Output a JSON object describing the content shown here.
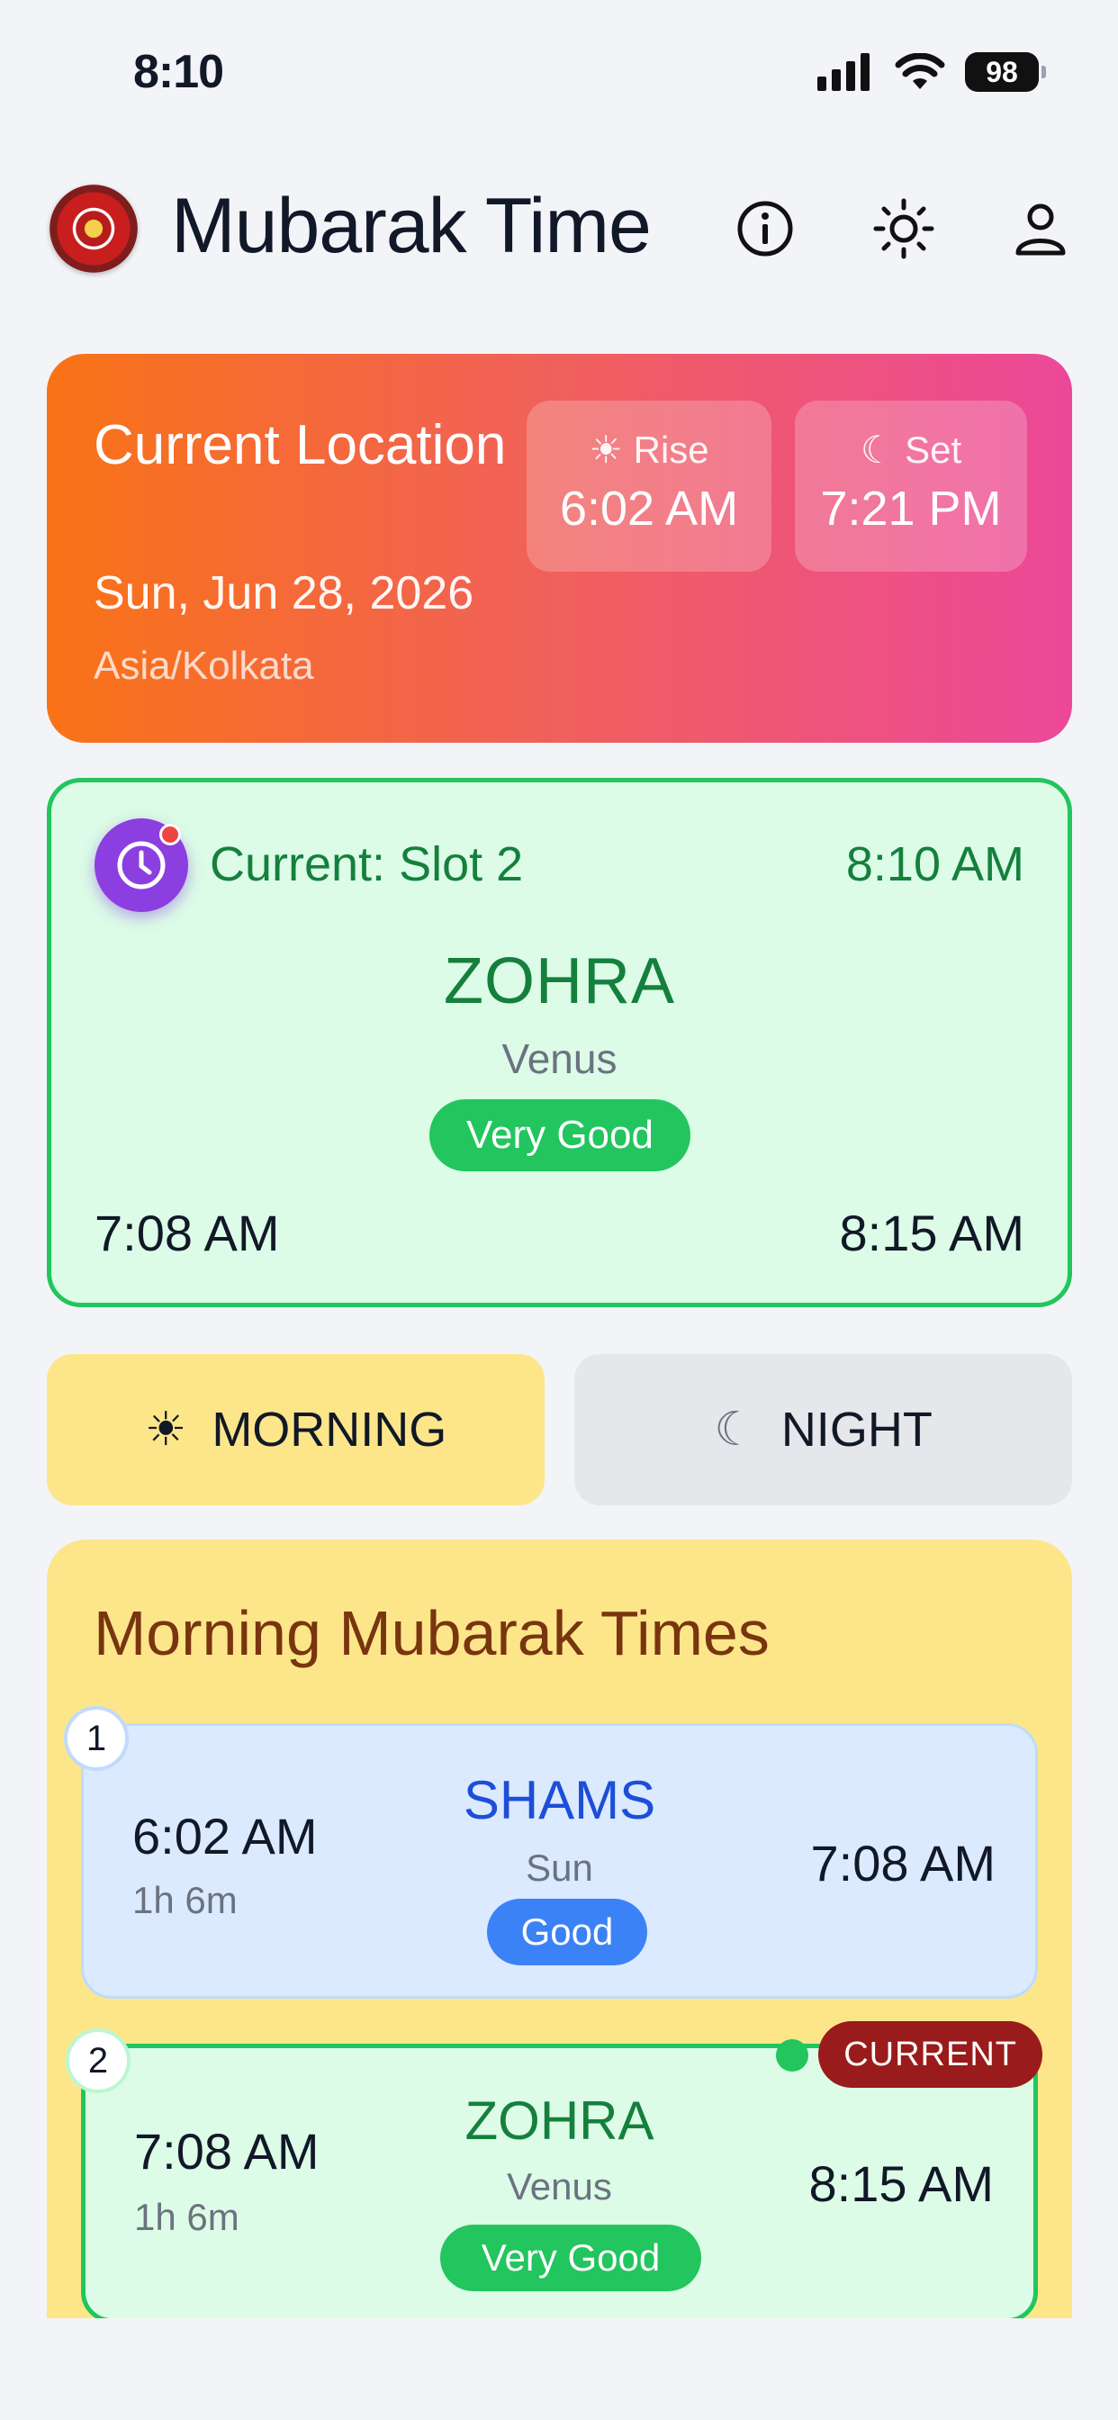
{
  "status_bar": {
    "time": "8:10",
    "battery": "98"
  },
  "header": {
    "title": "Mubarak Time"
  },
  "location": {
    "title": "Current Location",
    "date": "Sun, Jun 28, 2026",
    "timezone": "Asia/Kolkata",
    "rise_label": "☀ Rise",
    "rise_time": "6:02 AM",
    "set_label": "☾ Set",
    "set_time": "7:21 PM"
  },
  "current": {
    "label": "Current: Slot 2",
    "now": "8:10 AM",
    "planet": "ZOHRA",
    "planet_en": "Venus",
    "quality": "Very Good",
    "start": "7:08 AM",
    "end": "8:15 AM"
  },
  "toggle": {
    "morning_icon": "☀",
    "morning_label": "MORNING",
    "night_icon": "☾",
    "night_label": "NIGHT"
  },
  "times": {
    "title": "Morning Mubarak Times",
    "slots": [
      {
        "num": "1",
        "start": "6:02 AM",
        "duration": "1h 6m",
        "planet": "SHAMS",
        "planet_en": "Sun",
        "quality": "Good",
        "end": "7:08 AM"
      },
      {
        "num": "2",
        "start": "7:08 AM",
        "duration": "1h 6m",
        "planet": "ZOHRA",
        "planet_en": "Venus",
        "quality": "Very Good",
        "end": "8:15 AM",
        "badge": "CURRENT"
      }
    ]
  },
  "colors": {
    "accent_green": "#22c55e",
    "morning_yellow": "#fde68a",
    "current_badge": "#991b1b",
    "clock_purple": "#8b3fe0"
  }
}
